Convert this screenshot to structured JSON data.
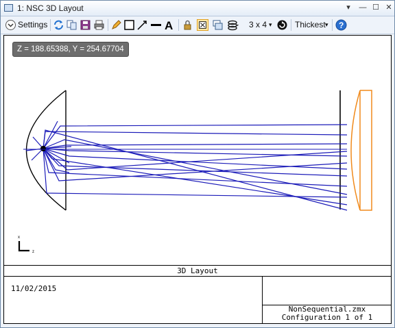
{
  "window": {
    "title": "1: NSC 3D Layout",
    "controls": [
      "▾",
      "—",
      "☐",
      "✕"
    ]
  },
  "toolbar": {
    "settings_label": "Settings",
    "layout_grid_label": "3 x 4",
    "line_thickness_label": "Thickest"
  },
  "plot": {
    "coord_readout": "Z = 188.65388, Y = 254.67704",
    "axis_x_label": "x",
    "axis_z_label": "z",
    "title": "3D Layout"
  },
  "info": {
    "date": "11/02/2015",
    "filename": "NonSequential.zmx",
    "configuration": "Configuration 1 of 1"
  },
  "colors": {
    "rays": "#1a1ab8",
    "lens": "#f08a1c",
    "geometry": "#000000"
  }
}
